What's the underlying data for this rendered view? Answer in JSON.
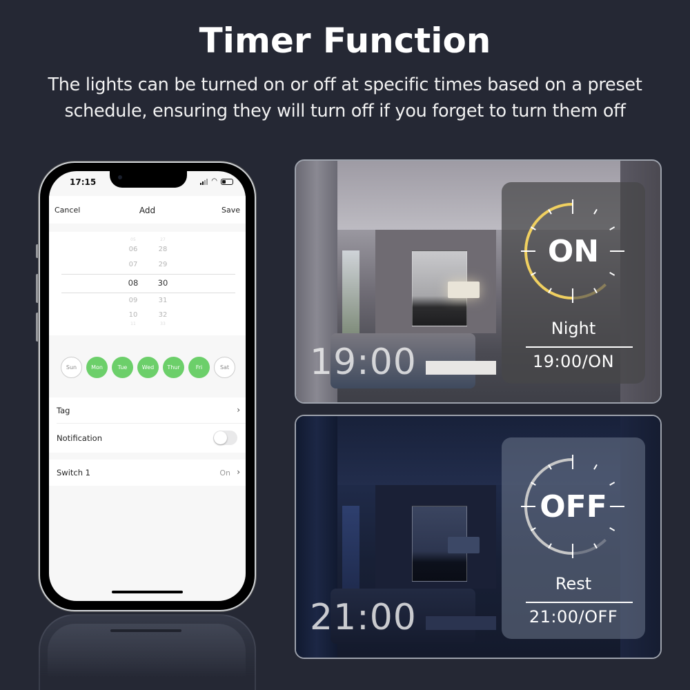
{
  "header": {
    "title": "Timer Function",
    "subtitle_line1": "The lights can be turned on or off at specific times based on a preset",
    "subtitle_line2": "schedule, ensuring they will turn off if you forget to turn them off"
  },
  "phone": {
    "status_time": "17:15",
    "nav": {
      "cancel": "Cancel",
      "title": "Add",
      "save": "Save"
    },
    "picker": {
      "hours": [
        "05",
        "06",
        "07",
        "08",
        "09",
        "10",
        "11"
      ],
      "minutes": [
        "27",
        "28",
        "29",
        "30",
        "31",
        "32",
        "33"
      ],
      "selected_hour": "08",
      "selected_minute": "30"
    },
    "days": [
      {
        "label": "Sun",
        "selected": false
      },
      {
        "label": "Mon",
        "selected": true
      },
      {
        "label": "Tue",
        "selected": true
      },
      {
        "label": "Wed",
        "selected": true
      },
      {
        "label": "Thur",
        "selected": true
      },
      {
        "label": "Fri",
        "selected": true
      },
      {
        "label": "Sat",
        "selected": false
      }
    ],
    "rows": {
      "tag": "Tag",
      "notification": "Notification",
      "notification_on": false,
      "switch_label": "Switch 1",
      "switch_value": "On"
    },
    "colors": {
      "day_selected": "#6ccf6a"
    }
  },
  "panels": [
    {
      "id": "on",
      "clock_time": "19:00",
      "state": "ON",
      "mode": "Night",
      "schedule": "19:00/ON",
      "arc_color": "#f0d060"
    },
    {
      "id": "off",
      "clock_time": "21:00",
      "state": "OFF",
      "mode": "Rest",
      "schedule": "21:00/OFF",
      "arc_color": "#c8c8c8"
    }
  ]
}
